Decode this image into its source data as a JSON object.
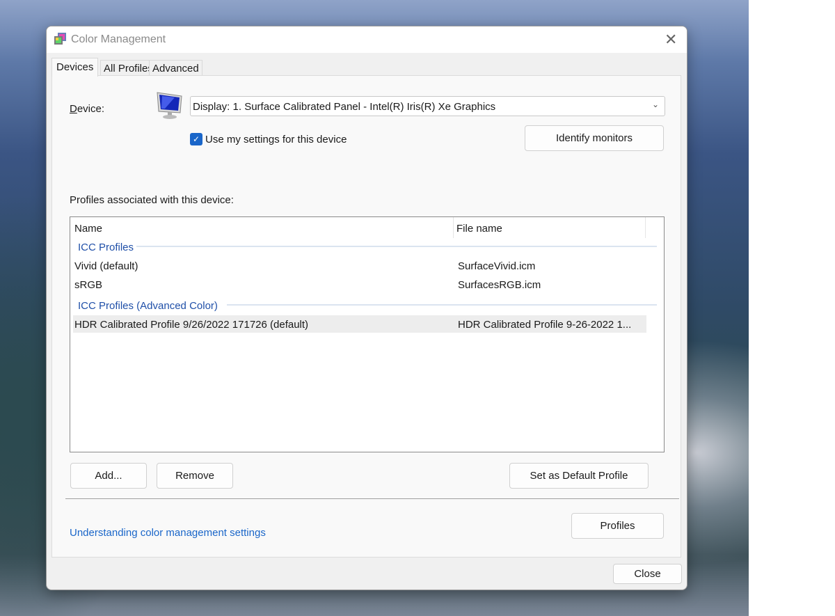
{
  "window": {
    "title": "Color Management",
    "close_icon": "close-icon"
  },
  "tabs": [
    {
      "label": "Devices",
      "active": true
    },
    {
      "label": "All Profiles"
    },
    {
      "label": "Advanced"
    }
  ],
  "device": {
    "label": "Device:",
    "value": "Display: 1. Surface Calibrated Panel - Intel(R) Iris(R) Xe Graphics",
    "use_settings_label": "Use my settings for this device",
    "use_settings_checked": true,
    "identify_label": "Identify monitors"
  },
  "profiles": {
    "label": "Profiles associated with this device:",
    "columns": [
      "Name",
      "File name"
    ],
    "groups": [
      {
        "name": "ICC Profiles",
        "rows": [
          {
            "name": "Vivid (default)",
            "file": "SurfaceVivid.icm"
          },
          {
            "name": "sRGB",
            "file": "SurfacesRGB.icm"
          }
        ]
      },
      {
        "name": "ICC Profiles (Advanced Color)",
        "rows": [
          {
            "name": "HDR Calibrated Profile 9/26/2022 171726 (default)",
            "file": "HDR Calibrated Profile 9-26-2022 1...",
            "selected": true
          }
        ]
      }
    ]
  },
  "buttons": {
    "add": "Add...",
    "remove": "Remove",
    "set_default": "Set as Default Profile",
    "profiles": "Profiles",
    "close": "Close"
  },
  "link": "Understanding color management settings",
  "colors": {
    "accent": "#1a66c9",
    "group_header": "#1f4fa8"
  }
}
